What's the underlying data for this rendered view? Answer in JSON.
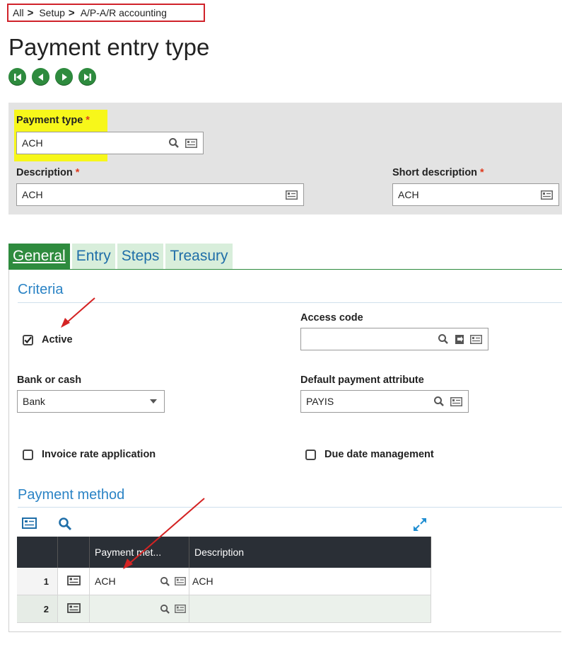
{
  "breadcrumb": {
    "items": [
      "All",
      "Setup",
      "A/P-A/R accounting"
    ],
    "separator": ">"
  },
  "page": {
    "title": "Payment entry type"
  },
  "nav": {
    "buttons": [
      "first-record",
      "previous-record",
      "next-record",
      "last-record"
    ]
  },
  "header": {
    "payment_type": {
      "label": "Payment type",
      "required": "*",
      "value": "ACH"
    },
    "description": {
      "label": "Description",
      "required": "*",
      "value": "ACH"
    },
    "short_description": {
      "label": "Short description",
      "required": "*",
      "value": "ACH"
    }
  },
  "tabs": [
    {
      "label": "General",
      "active": true
    },
    {
      "label": "Entry"
    },
    {
      "label": "Steps"
    },
    {
      "label": "Treasury"
    }
  ],
  "criteria": {
    "title": "Criteria",
    "active": {
      "label": "Active",
      "checked": true
    },
    "access_code": {
      "label": "Access code",
      "value": ""
    },
    "bank_or_cash": {
      "label": "Bank or cash",
      "value": "Bank"
    },
    "default_payment_attribute": {
      "label": "Default payment attribute",
      "value": "PAYIS"
    },
    "invoice_rate_application": {
      "label": "Invoice rate application",
      "checked": false
    },
    "due_date_management": {
      "label": "Due date management",
      "checked": false
    }
  },
  "payment_method": {
    "title": "Payment method",
    "columns": [
      "Payment met...",
      "Description"
    ],
    "rows": [
      {
        "num": "1",
        "method": "ACH",
        "description": "ACH"
      },
      {
        "num": "2",
        "method": "",
        "description": ""
      }
    ]
  },
  "colors": {
    "accent_green": "#2e8b3e",
    "link_blue": "#2a83c5",
    "highlight_yellow": "#f7f71a",
    "required_red": "#e03a1e",
    "annotation_red": "#d0222a"
  },
  "icons": [
    "magnifier-icon",
    "detail-card-icon",
    "jump-link-icon",
    "expand-icon",
    "checkmark-icon",
    "dropdown-caret-icon"
  ]
}
